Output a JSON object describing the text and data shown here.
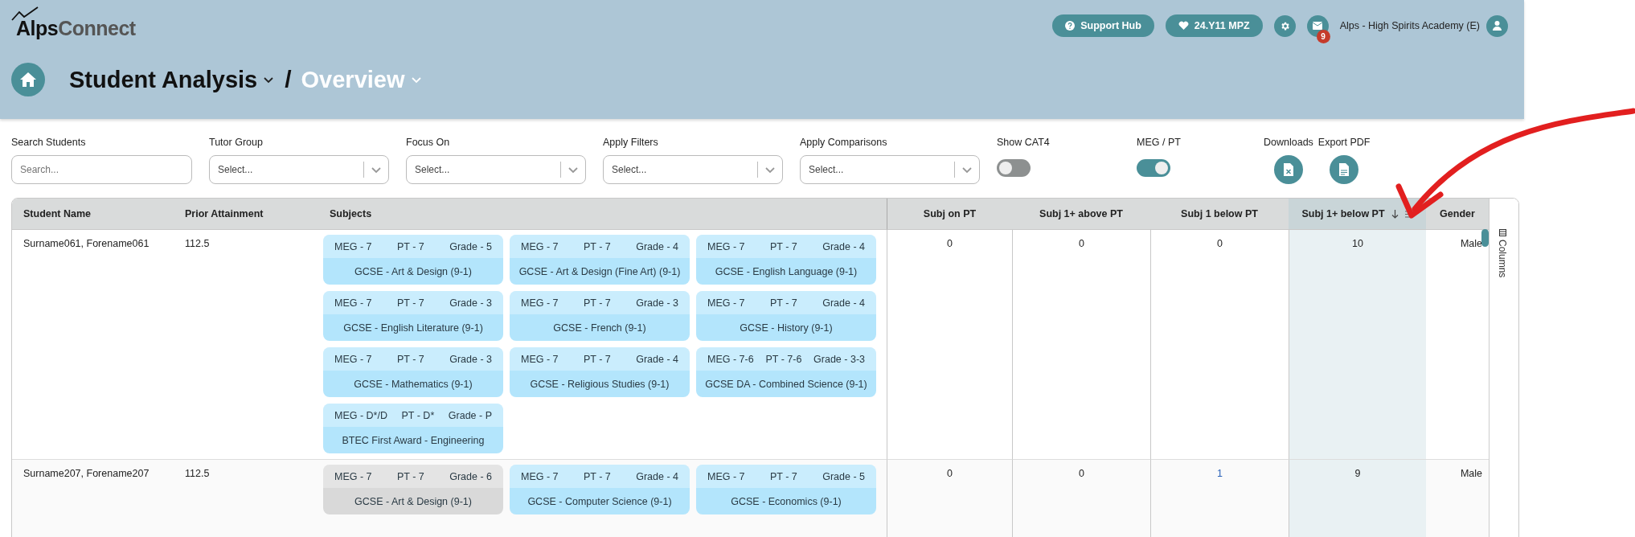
{
  "header": {
    "logo": {
      "part_1": "Alps",
      "part_2": "Connect"
    },
    "support_button": "Support Hub",
    "cohort_button": "24.Y11 MPZ",
    "mail_badge": "9",
    "school": "Alps - High Spirits Academy (E)"
  },
  "breadcrumb": {
    "section": "Student Analysis",
    "separator": "/",
    "page": "Overview"
  },
  "filters": [
    {
      "kind": "search",
      "label": "Search Students",
      "placeholder": "Search..."
    },
    {
      "kind": "select",
      "label": "Tutor Group",
      "placeholder": "Select..."
    },
    {
      "kind": "select",
      "label": "Focus On",
      "placeholder": "Select..."
    },
    {
      "kind": "select",
      "label": "Apply Filters",
      "placeholder": "Select..."
    },
    {
      "kind": "select",
      "label": "Apply Comparisons",
      "placeholder": "Select..."
    },
    {
      "kind": "toggle",
      "label": "Show CAT4",
      "on": false
    },
    {
      "kind": "toggle",
      "label": "MEG / PT",
      "on": true
    }
  ],
  "exports": [
    {
      "kind": "excel",
      "label": "Downloads"
    },
    {
      "kind": "pdf",
      "label": "Export PDF"
    }
  ],
  "table": {
    "columns": [
      {
        "label": "Student Name",
        "sorted": false
      },
      {
        "label": "Prior Attainment",
        "sorted": false
      },
      {
        "label": "Subjects",
        "sorted": false
      },
      {
        "label": "Subj on PT",
        "sorted": false
      },
      {
        "label": "Subj 1+ above PT",
        "sorted": false
      },
      {
        "label": "Subj 1 below PT",
        "sorted": false
      },
      {
        "label": "Subj 1+ below PT",
        "sorted": true
      },
      {
        "label": "Gender",
        "sorted": false
      }
    ],
    "rows": [
      {
        "student": "Surname061, Forename061",
        "prior_attainment": "112.5",
        "subjects": [
          {
            "meg": "MEG - 7",
            "pt": "PT - 7",
            "grade": "Grade - 5",
            "name": "GCSE - Art & Design (9-1)",
            "color": "#b3e5fc"
          },
          {
            "meg": "MEG - 7",
            "pt": "PT - 7",
            "grade": "Grade - 4",
            "name": "GCSE - Art & Design (Fine Art) (9-1)",
            "color": "#b3e5fc"
          },
          {
            "meg": "MEG - 7",
            "pt": "PT - 7",
            "grade": "Grade - 4",
            "name": "GCSE - English Language (9-1)",
            "color": "#b3e5fc"
          },
          {
            "meg": "MEG - 7",
            "pt": "PT - 7",
            "grade": "Grade - 3",
            "name": "GCSE - English Literature (9-1)",
            "color": "#b3e5fc"
          },
          {
            "meg": "MEG - 7",
            "pt": "PT - 7",
            "grade": "Grade - 3",
            "name": "GCSE - French (9-1)",
            "color": "#b3e5fc"
          },
          {
            "meg": "MEG - 7",
            "pt": "PT - 7",
            "grade": "Grade - 4",
            "name": "GCSE - History (9-1)",
            "color": "#b3e5fc"
          },
          {
            "meg": "MEG - 7",
            "pt": "PT - 7",
            "grade": "Grade - 3",
            "name": "GCSE - Mathematics (9-1)",
            "color": "#b3e5fc"
          },
          {
            "meg": "MEG - 7",
            "pt": "PT - 7",
            "grade": "Grade - 4",
            "name": "GCSE - Religious Studies (9-1)",
            "color": "#b3e5fc"
          },
          {
            "meg": "MEG - 7-6",
            "pt": "PT - 7-6",
            "grade": "Grade - 3-3",
            "name": "GCSE DA - Combined Science (9-1)",
            "color": "#b3e5fc"
          },
          {
            "meg": "MEG - D*/D",
            "pt": "PT - D*",
            "grade": "Grade - P",
            "name": "BTEC First Award - Engineering",
            "color": "#b3e5fc"
          }
        ],
        "on_pt": "0",
        "above_pt": "0",
        "one_below_pt": "0",
        "plus_below_pt": "10",
        "gender": "Male"
      },
      {
        "student": "Surname207, Forename207",
        "prior_attainment": "112.5",
        "subjects": [
          {
            "meg": "MEG - 7",
            "pt": "PT - 7",
            "grade": "Grade - 6",
            "name": "GCSE - Art & Design (9-1)",
            "color": "#d9d9d9"
          },
          {
            "meg": "MEG - 7",
            "pt": "PT - 7",
            "grade": "Grade - 4",
            "name": "GCSE - Computer Science (9-1)",
            "color": "#b3e5fc"
          },
          {
            "meg": "MEG - 7",
            "pt": "PT - 7",
            "grade": "Grade - 5",
            "name": "GCSE - Economics (9-1)",
            "color": "#b3e5fc"
          }
        ],
        "on_pt": "0",
        "above_pt": "0",
        "one_below_pt": "1",
        "plus_below_pt": "9",
        "gender": "Male"
      }
    ]
  },
  "side_panel": {
    "label": "Columns"
  }
}
